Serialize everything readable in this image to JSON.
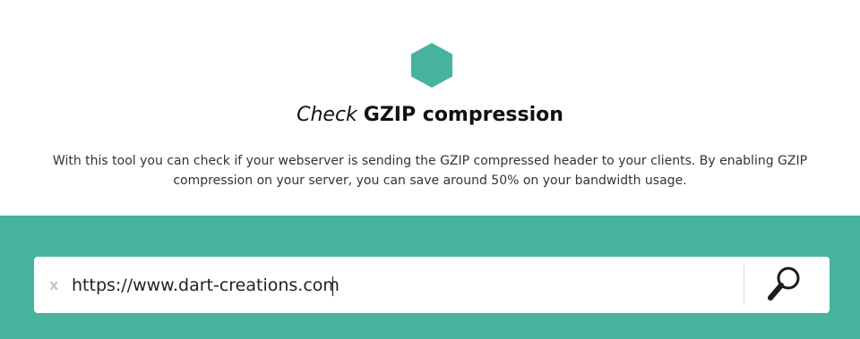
{
  "header": {
    "logo_icon": "hexagon-icon",
    "logo_color": "#47b29d",
    "title_italic": "Check",
    "title_bold": "GZIP compression",
    "description": "With this tool you can check if your webserver is sending the GZIP compressed header to your clients. By enabling GZIP compression on your server, you can save around 50% on your bandwidth usage."
  },
  "search": {
    "clear_label": "x",
    "value": "https://www.dart-creations.com",
    "button_icon": "magnifier-icon"
  },
  "colors": {
    "accent": "#47b29d",
    "background": "#ffffff"
  }
}
